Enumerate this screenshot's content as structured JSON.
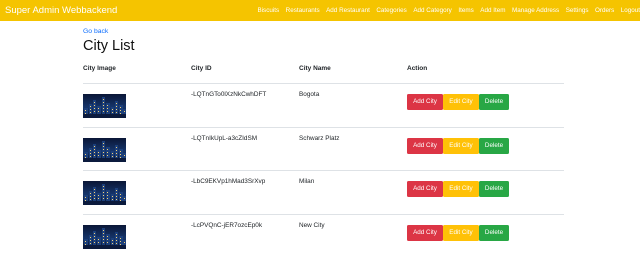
{
  "navbar": {
    "brand": "Super Admin Webbackend",
    "links": [
      "Biscuits",
      "Restaurants",
      "Add Restaurant",
      "Categories",
      "Add Category",
      "Items",
      "Add Item",
      "Manage Address",
      "Settings",
      "Orders",
      "Logout"
    ]
  },
  "page": {
    "go_back": "Go back",
    "title": "City List"
  },
  "table": {
    "headers": [
      "City Image",
      "City ID",
      "City Name",
      "Action"
    ],
    "rows": [
      {
        "id": "-LQTnGTo0lXzNkCwhDFT",
        "name": "Bogota"
      },
      {
        "id": "-LQTnIkUpL-a3cZIdSM",
        "name": "Schwarz Platz"
      },
      {
        "id": "-LbC9EKVp1hMad3SrXvp",
        "name": "Milan"
      },
      {
        "id": "-LcPVQnC-jER7ozcEp0k",
        "name": "New City"
      }
    ],
    "actions": {
      "add": "Add City",
      "edit": "Edit City",
      "delete": "Delete"
    }
  },
  "colors": {
    "navbar": "#f5c400",
    "add": "#dc3545",
    "edit": "#ffc107",
    "delete": "#28a745",
    "link": "#0d6efd"
  }
}
